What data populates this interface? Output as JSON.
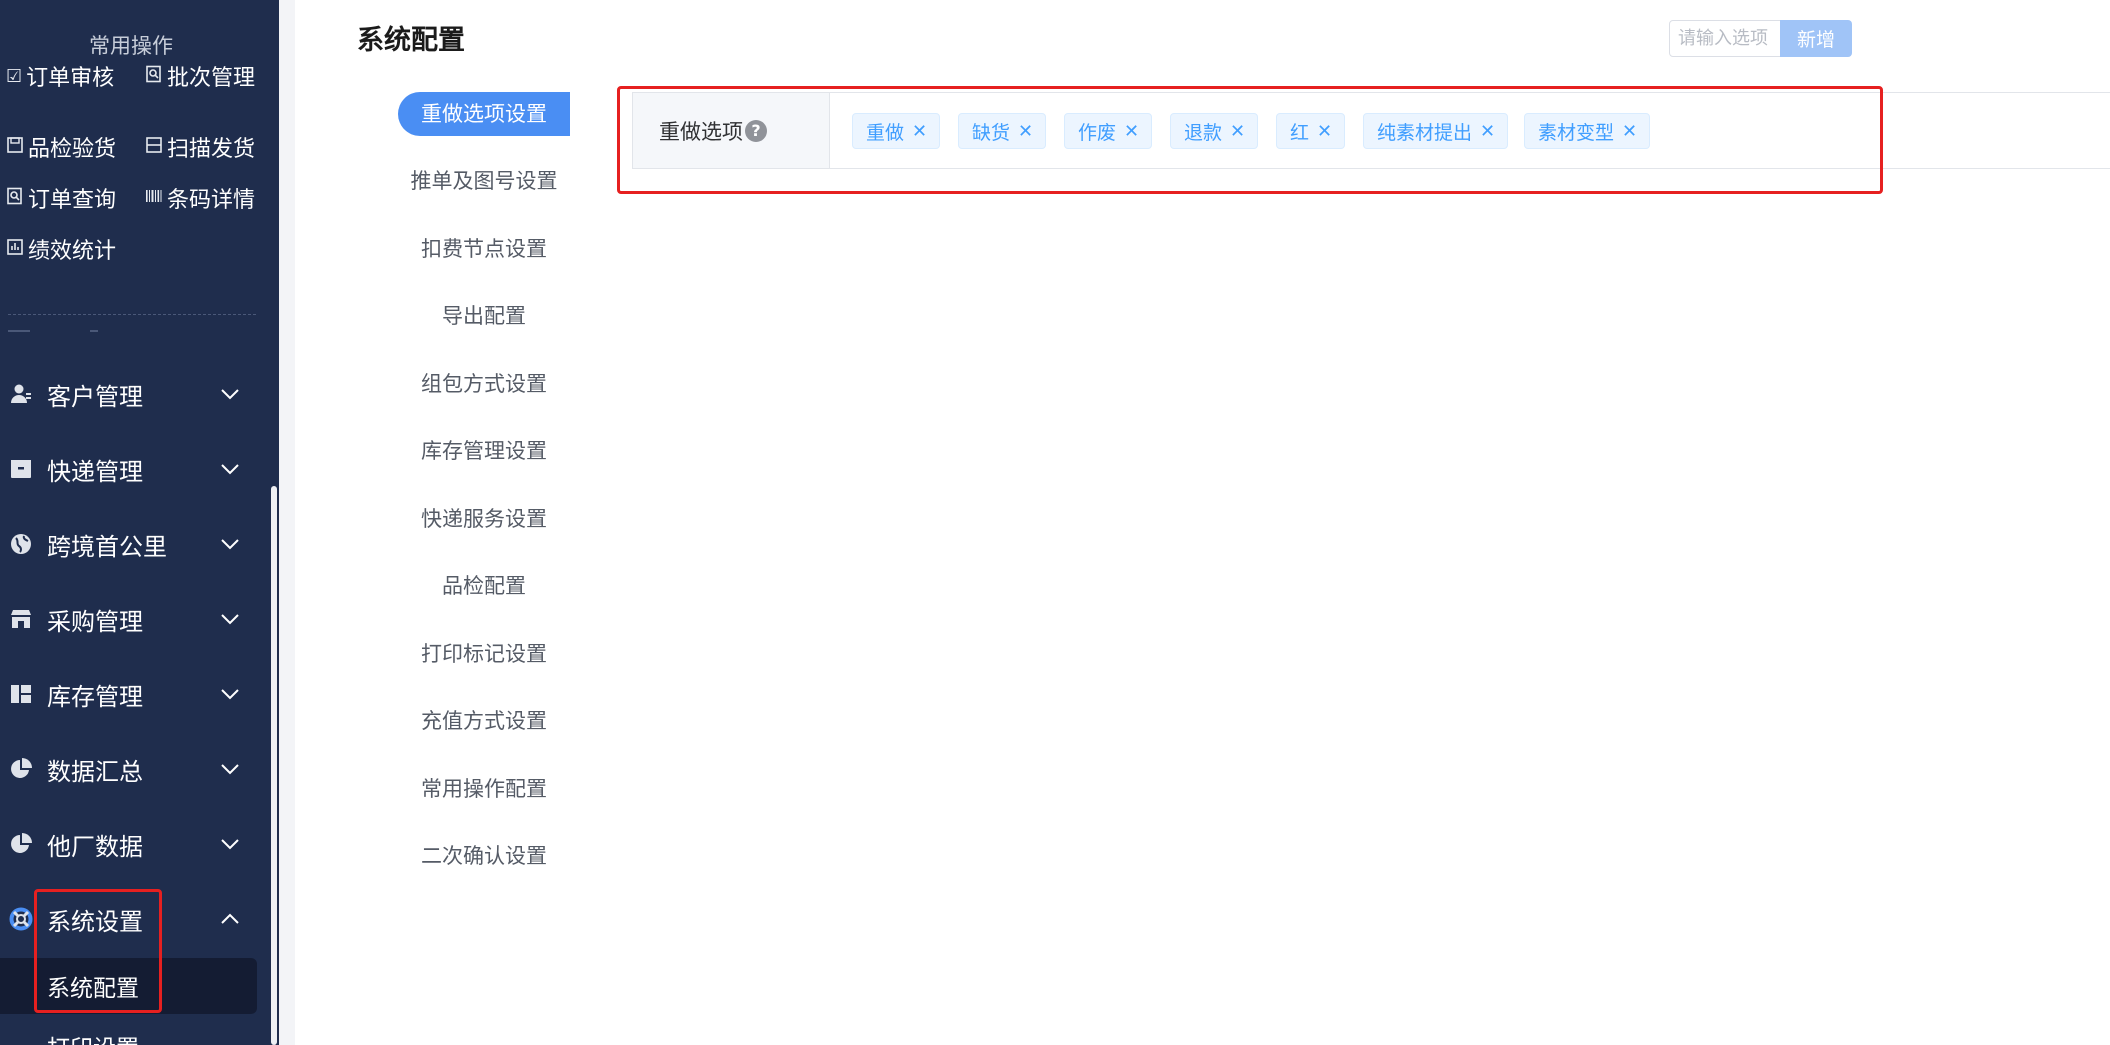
{
  "sidebar": {
    "quick_title": "常用操作",
    "quick_items": [
      {
        "label": "订单审核",
        "icon": "checkbox-icon"
      },
      {
        "label": "批次管理",
        "icon": "doc-search-icon"
      },
      {
        "label": "品检验货",
        "icon": "save-icon"
      },
      {
        "label": "扫描发货",
        "icon": "scan-icon"
      },
      {
        "label": "订单查询",
        "icon": "doc-search-icon"
      },
      {
        "label": "条码详情",
        "icon": "barcode-icon"
      },
      {
        "label": "绩效统计",
        "icon": "chart-icon"
      }
    ],
    "menu": [
      {
        "label": "客户管理",
        "icon": "user-icon"
      },
      {
        "label": "快递管理",
        "icon": "package-icon"
      },
      {
        "label": "跨境首公里",
        "icon": "globe-icon"
      },
      {
        "label": "采购管理",
        "icon": "store-icon"
      },
      {
        "label": "库存管理",
        "icon": "warehouse-icon"
      },
      {
        "label": "数据汇总",
        "icon": "pie-chart-icon"
      },
      {
        "label": "他厂数据",
        "icon": "pie-chart-icon"
      },
      {
        "label": "系统设置",
        "icon": "lifebuoy-icon"
      }
    ],
    "sub_items": [
      {
        "label": "系统配置"
      },
      {
        "label": "打印设置"
      }
    ]
  },
  "main": {
    "title": "系统配置",
    "nav": [
      "重做选项设置",
      "推单及图号设置",
      "扣费节点设置",
      "导出配置",
      "组包方式设置",
      "库存管理设置",
      "快递服务设置",
      "品检配置",
      "打印标记设置",
      "充值方式设置",
      "常用操作配置",
      "二次确认设置"
    ],
    "row": {
      "label": "重做选项",
      "help": "?",
      "tags": [
        "重做",
        "缺货",
        "作废",
        "退款",
        "红",
        "纯素材提出",
        "素材变型"
      ],
      "input_placeholder": "请输入选项",
      "add_label": "新增"
    }
  },
  "colors": {
    "sidebar_bg": "#1f2d4d",
    "accent": "#4a8ef3",
    "tag_text": "#409eff",
    "highlight_border": "#e62020"
  }
}
